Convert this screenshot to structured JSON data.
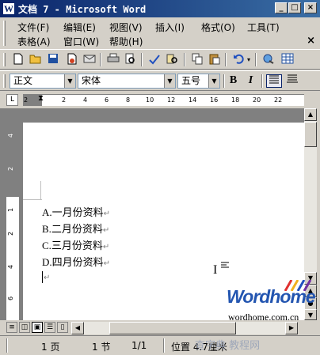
{
  "window": {
    "title": "文档 7 - Microsoft Word",
    "icon": "word-app-icon",
    "icon_letter": "W",
    "minimize": "_",
    "maximize": "□",
    "close": "×"
  },
  "menu": {
    "items": [
      "文件(F)",
      "编辑(E)",
      "视图(V)",
      "插入(I)",
      "格式(O)",
      "工具(T)",
      "表格(A)",
      "窗口(W)",
      "帮助(H)"
    ],
    "close_doc": "×"
  },
  "formatting": {
    "style": "正文",
    "font": "宋体",
    "size": "五号",
    "bold": "B",
    "italic": "I"
  },
  "ruler": {
    "corner_tab": "L",
    "ticks": [
      "2",
      "2",
      "4",
      "6",
      "8",
      "10",
      "12",
      "14",
      "16",
      "18",
      "20",
      "22"
    ],
    "vticks": [
      "4",
      "2",
      "1",
      "2",
      "4",
      "6"
    ]
  },
  "document": {
    "lines": [
      "A.一月份资料",
      "B.二月份资料",
      "C.三月份资料",
      "D.四月份资料"
    ],
    "para_mark": "↵"
  },
  "watermark": {
    "logo": "Wordhome",
    "url": "wordhome.com.cn",
    "footer": "查字典 教程网"
  },
  "status": {
    "page": "1 页",
    "section": "1 节",
    "page_of": "1/1",
    "position": "位置 4.7厘米"
  },
  "colors": {
    "title_bar": "#0a246a",
    "logo": "#2355b0"
  }
}
